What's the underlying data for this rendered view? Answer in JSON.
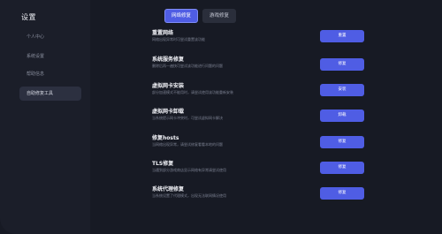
{
  "sidebar": {
    "title": "设置",
    "items": [
      {
        "label": "个人中心"
      },
      {
        "label": "系统设置"
      },
      {
        "label": "帮助信息"
      },
      {
        "label": "自助修复工具"
      }
    ]
  },
  "tabs": [
    {
      "label": "网络修复"
    },
    {
      "label": "游戏修复"
    }
  ],
  "tools": [
    {
      "title": "重置网络",
      "desc": "网络出现异常时可尝试重置该功能",
      "button": "重置"
    },
    {
      "title": "系统服务修复",
      "desc": "删除后再一遍快可尝试该功能进行问题的问题",
      "button": "修复"
    },
    {
      "title": "虚拟网卡安装",
      "desc": "部分加速模式不能用时，请尝试使用该功能重新安装",
      "button": "安装"
    },
    {
      "title": "虚拟网卡卸载",
      "desc": "当系统提示网卡冲突时，可尝试虚拟网卡解决",
      "button": "卸载"
    },
    {
      "title": "修复hosts",
      "desc": "当网络出现异常，请尝试修复看看本地的问题",
      "button": "修复"
    },
    {
      "title": "TLS修复",
      "desc": "当遇到部分游戏商店显示网络有异常请尝试使用",
      "button": "修复"
    },
    {
      "title": "系统代理修复",
      "desc": "当系统设置了代理模式，出现无法联网情况使用",
      "button": "修复"
    }
  ]
}
